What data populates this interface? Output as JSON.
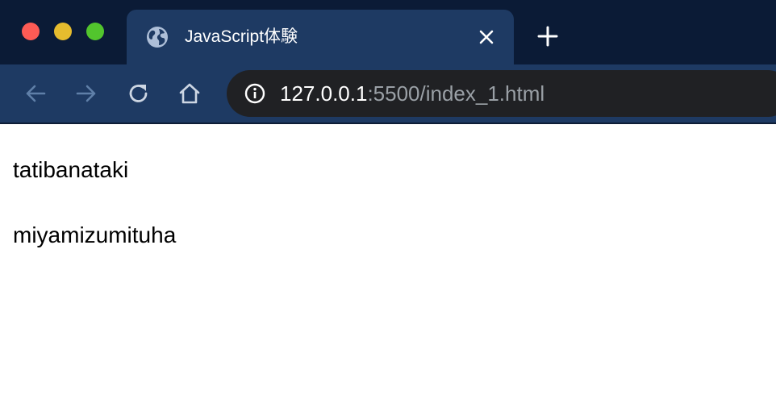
{
  "window": {
    "traffic_lights": {
      "close_color": "#fd5b55",
      "minimize_color": "#e6bc2e",
      "zoom_color": "#52c52d"
    }
  },
  "tab": {
    "title": "JavaScript体験",
    "icon": "globe-icon",
    "close_icon": "close-icon"
  },
  "new_tab_icon": "plus-icon",
  "toolbar": {
    "back_icon": "arrow-left-icon",
    "forward_icon": "arrow-right-icon",
    "reload_icon": "reload-icon",
    "home_icon": "home-icon"
  },
  "address_bar": {
    "info_icon": "info-icon",
    "url_host": "127.0.0.1",
    "url_rest": ":5500/index_1.html"
  },
  "page": {
    "paragraphs": [
      "tatibanataki",
      "miyamizumituha"
    ]
  },
  "colors": {
    "tabstrip_bg": "#0b1b36",
    "tab_bg": "#1e3a63",
    "omnibox_bg": "#202124"
  }
}
